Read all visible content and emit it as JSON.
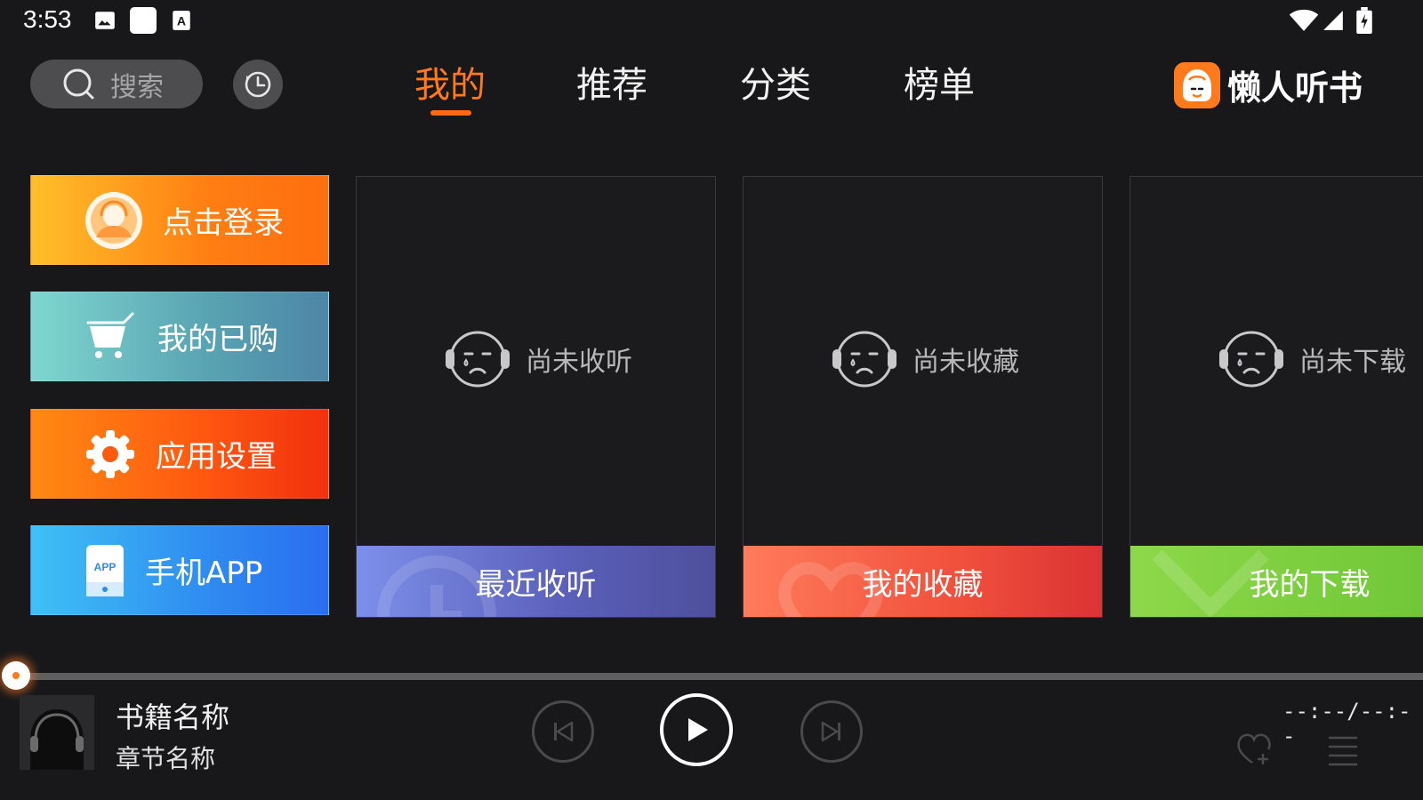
{
  "status_bar": {
    "time": "3:53",
    "icons": [
      "gallery-icon",
      "square-notification-icon",
      "a-text-icon",
      "wifi-icon",
      "cell-signal-icon",
      "battery-icon"
    ]
  },
  "header": {
    "search_placeholder": "搜索",
    "tabs": [
      {
        "label": "我的",
        "active": true
      },
      {
        "label": "推荐",
        "active": false
      },
      {
        "label": "分类",
        "active": false
      },
      {
        "label": "榜单",
        "active": false
      }
    ],
    "brand_name": "懒人听书",
    "accent_color": "#ff7a1a"
  },
  "menu": {
    "login": "点击登录",
    "purchased": "我的已购",
    "settings": "应用设置",
    "app": "手机APP",
    "app_icon_text": "APP"
  },
  "cards": [
    {
      "empty_text": "尚未收听",
      "footer": "最近收听"
    },
    {
      "empty_text": "尚未收藏",
      "footer": "我的收藏"
    },
    {
      "empty_text": "尚未下载",
      "footer": "我的下载"
    }
  ],
  "player": {
    "book_name": "书籍名称",
    "chapter_name": "章节名称",
    "time": "--:--/--:--",
    "progress": 0
  }
}
